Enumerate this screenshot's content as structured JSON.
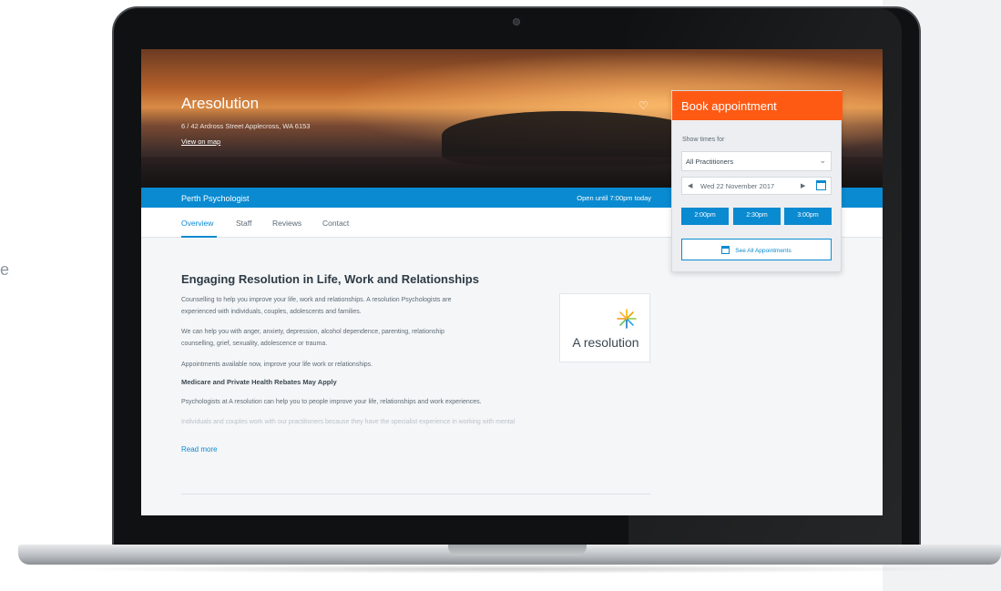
{
  "side_text": "e",
  "hero": {
    "title": "Aresolution",
    "address": "6 / 42 Ardross Street Applecross, WA 6153",
    "map_link": "View on map"
  },
  "bar": {
    "category": "Perth Psychologist",
    "hours": "Open until 7:00pm today"
  },
  "tabs": [
    "Overview",
    "Staff",
    "Reviews",
    "Contact"
  ],
  "content": {
    "heading": "Engaging Resolution in Life, Work and Relationships",
    "p1_line1": "Counselling to help you improve your life, work and relationships. A resolution Psychologists are",
    "p1_line2": "experienced with individuals, couples, adolescents and families.",
    "p2_line1": "We can help you with anger, anxiety, depression, alcohol dependence, parenting, relationship",
    "p2_line2": "counselling, grief, sexuality, adolescence or trauma.",
    "p3": "Appointments available now, improve your life work or relationships.",
    "subhead": "Medicare and Private Health Rebates May Apply",
    "p4": "Psychologists at A resolution can help you to people improve your life, relationships and work experiences.",
    "p5_faded": "Individuals and couples work with our practitioners because they have the specialist experience in working with mental",
    "read_more": "Read more",
    "logo_text": "A resolution"
  },
  "booking": {
    "title": "Book appointment",
    "show_label": "Show times for",
    "practitioner": "All Practitioners",
    "date": "Wed 22 November 2017",
    "slots": [
      "2:00pm",
      "2:30pm",
      "3:00pm"
    ],
    "see_all": "See All Appointments"
  },
  "colors": {
    "accent_blue": "#0a8ad0",
    "accent_orange": "#ff5a14"
  },
  "icons": {
    "heart": "heart-icon",
    "calendar": "calendar-icon",
    "chevron": "chevron-down-icon"
  }
}
